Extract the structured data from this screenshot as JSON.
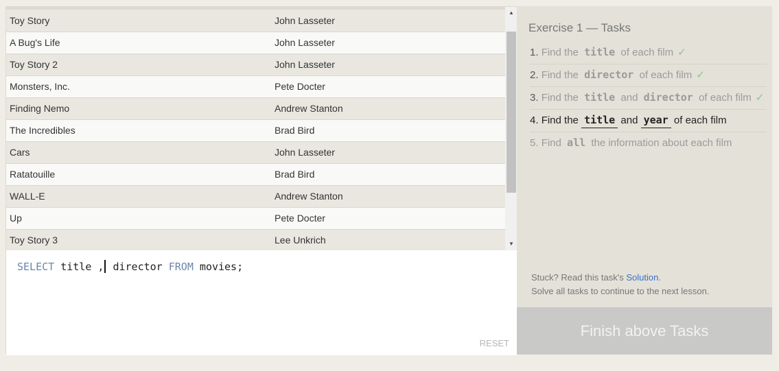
{
  "results": {
    "rows": [
      {
        "title": "Toy Story",
        "director": "John Lasseter"
      },
      {
        "title": "A Bug's Life",
        "director": "John Lasseter"
      },
      {
        "title": "Toy Story 2",
        "director": "John Lasseter"
      },
      {
        "title": "Monsters, Inc.",
        "director": "Pete Docter"
      },
      {
        "title": "Finding Nemo",
        "director": "Andrew Stanton"
      },
      {
        "title": "The Incredibles",
        "director": "Brad Bird"
      },
      {
        "title": "Cars",
        "director": "John Lasseter"
      },
      {
        "title": "Ratatouille",
        "director": "Brad Bird"
      },
      {
        "title": "WALL-E",
        "director": "Andrew Stanton"
      },
      {
        "title": "Up",
        "director": "Pete Docter"
      },
      {
        "title": "Toy Story 3",
        "director": "Lee Unkrich"
      }
    ]
  },
  "editor": {
    "kw_select": "SELECT",
    "part1": " title ,",
    "part2": " director ",
    "kw_from": "FROM",
    "part3": " movies;",
    "reset_label": "RESET"
  },
  "exercise": {
    "title": "Exercise 1 — Tasks",
    "check_mark": "✓",
    "tasks": [
      {
        "num": "1.",
        "pre": "Find the",
        "code": "title",
        "post": "of each film",
        "status": "done"
      },
      {
        "num": "2.",
        "pre": "Find the",
        "code": "director",
        "post": "of each film",
        "status": "done"
      },
      {
        "num": "3.",
        "pre": "Find the",
        "code": "title",
        "mid": "and",
        "code2": "director",
        "post": "of each film",
        "status": "done"
      },
      {
        "num": "4.",
        "pre": "Find the",
        "code": "title",
        "mid": "and",
        "code2": "year",
        "post": "of each film",
        "status": "active"
      },
      {
        "num": "5.",
        "pre": "Find",
        "code": "all",
        "post": "the information about each film",
        "status": "pending"
      }
    ],
    "help_prefix": "Stuck? Read this task's ",
    "solution_label": "Solution",
    "help_suffix": ".",
    "help_line2": "Solve all tasks to continue to the next lesson.",
    "finish_label": "Finish above Tasks"
  },
  "icons": {
    "scroll_up": "▲",
    "scroll_down": "▼"
  }
}
